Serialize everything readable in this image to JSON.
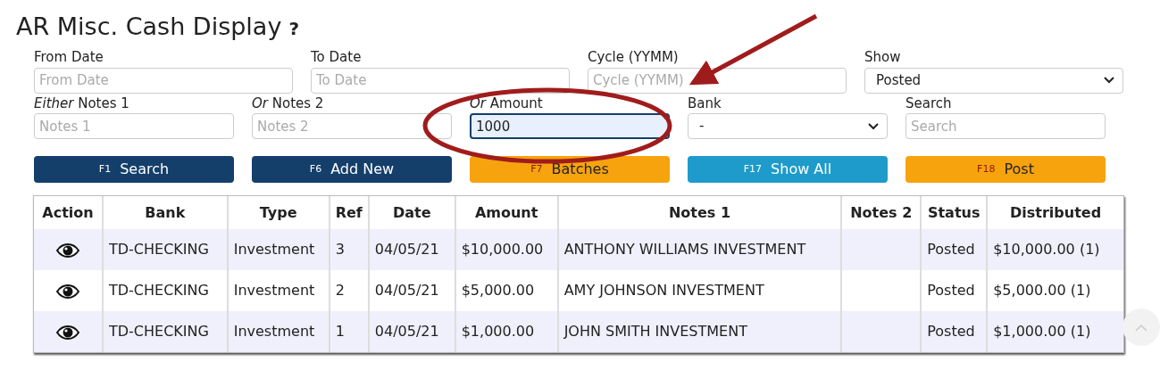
{
  "title": "AR Misc. Cash Display",
  "help_icon": "?",
  "filter_rows": [
    [
      {
        "kind": "input",
        "label": "From Date",
        "placeholder": "From Date"
      },
      {
        "kind": "input",
        "label": "To Date",
        "placeholder": "To Date"
      },
      {
        "kind": "input",
        "label": "Cycle (YYMM)",
        "placeholder": "Cycle (YYMM)"
      },
      {
        "kind": "select",
        "label": "Show",
        "value": "Posted"
      }
    ],
    [
      {
        "kind": "input",
        "label": "*Either* Notes 1",
        "placeholder": "Notes 1"
      },
      {
        "kind": "input",
        "label": "*Or* Notes 2",
        "placeholder": "Notes 2"
      },
      {
        "kind": "input",
        "label": "*Or* Amount",
        "value": "1000",
        "focused": true
      },
      {
        "kind": "select",
        "label": "Bank",
        "value": "-"
      },
      {
        "kind": "input",
        "label": "Search",
        "placeholder": "Search"
      }
    ]
  ],
  "buttons": [
    {
      "key": "F1",
      "label": "Search",
      "kind": "primary"
    },
    {
      "key": "F6",
      "label": "Add New",
      "kind": "primary"
    },
    {
      "key": "F7",
      "label": "Batches",
      "kind": "warning"
    },
    {
      "key": "F17",
      "label": "Show All",
      "kind": "info"
    },
    {
      "key": "F18",
      "label": "Post",
      "kind": "warning"
    }
  ],
  "table": {
    "columns": [
      "Action",
      "Bank",
      "Type",
      "Ref",
      "Date",
      "Amount",
      "Notes 1",
      "Notes 2",
      "Status",
      "Distributed"
    ],
    "rows": [
      [
        "",
        "TD-CHECKING",
        "Investment",
        "3",
        "04/05/21",
        "$10,000.00",
        "ANTHONY WILLIAMS INVESTMENT",
        "",
        "Posted",
        "$10,000.00 (1)"
      ],
      [
        "",
        "TD-CHECKING",
        "Investment",
        "2",
        "04/05/21",
        "$5,000.00",
        "AMY JOHNSON INVESTMENT",
        "",
        "Posted",
        "$5,000.00 (1)"
      ],
      [
        "",
        "TD-CHECKING",
        "Investment",
        "1",
        "04/05/21",
        "$1,000.00",
        "JOHN SMITH INVESTMENT",
        "",
        "Posted",
        "$1,000.00 (1)"
      ]
    ]
  }
}
